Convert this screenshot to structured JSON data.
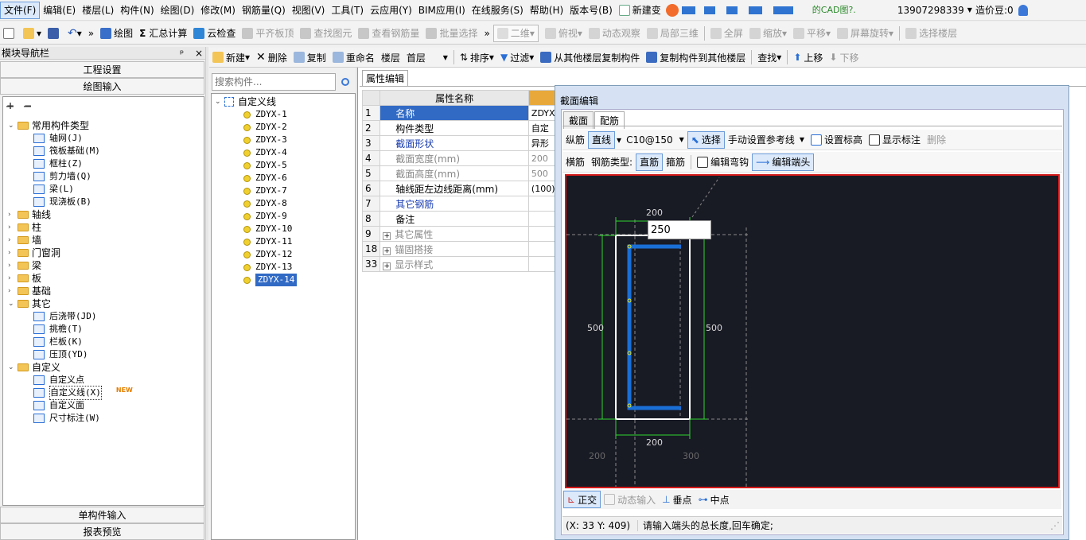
{
  "menu": [
    "文件(F)",
    "编辑(E)",
    "楼层(L)",
    "构件(N)",
    "绘图(D)",
    "修改(M)",
    "钢筋量(Q)",
    "视图(V)",
    "工具(T)",
    "云应用(Y)",
    "BIM应用(I)",
    "在线服务(S)",
    "帮助(H)",
    "版本号(B)"
  ],
  "menu_extra": {
    "new_label": "新建变",
    "cad_hint": "的CAD图?.",
    "phone": "13907298339",
    "price_label": "造价豆:0"
  },
  "toolbar": [
    "绘图",
    "汇总计算",
    "云检查",
    "平齐板顶",
    "查找图元",
    "查看钢筋量",
    "批量选择",
    "二维",
    "俯视",
    "动态观察",
    "局部三维",
    "全屏",
    "缩放",
    "平移",
    "屏幕旋转",
    "选择楼层"
  ],
  "left_panel": {
    "title": "模块导航栏",
    "pin": "ᵖ",
    "close": "×",
    "btn_project": "工程设置",
    "btn_draw": "绘图输入",
    "btn_single": "单构件输入",
    "btn_report": "报表预览",
    "tree": [
      {
        "label": "常用构件类型",
        "level": 0,
        "type": "folder",
        "open": true
      },
      {
        "label": "轴网(J)",
        "level": 1,
        "type": "item"
      },
      {
        "label": "筏板基础(M)",
        "level": 1,
        "type": "item"
      },
      {
        "label": "框柱(Z)",
        "level": 1,
        "type": "item"
      },
      {
        "label": "剪力墙(Q)",
        "level": 1,
        "type": "item"
      },
      {
        "label": "梁(L)",
        "level": 1,
        "type": "item"
      },
      {
        "label": "现浇板(B)",
        "level": 1,
        "type": "item"
      },
      {
        "label": "轴线",
        "level": 0,
        "type": "folder",
        "open": false
      },
      {
        "label": "柱",
        "level": 0,
        "type": "folder",
        "open": false
      },
      {
        "label": "墙",
        "level": 0,
        "type": "folder",
        "open": false
      },
      {
        "label": "门窗洞",
        "level": 0,
        "type": "folder",
        "open": false
      },
      {
        "label": "梁",
        "level": 0,
        "type": "folder",
        "open": false
      },
      {
        "label": "板",
        "level": 0,
        "type": "folder",
        "open": false
      },
      {
        "label": "基础",
        "level": 0,
        "type": "folder",
        "open": false
      },
      {
        "label": "其它",
        "level": 0,
        "type": "folder",
        "open": true
      },
      {
        "label": "后浇带(JD)",
        "level": 1,
        "type": "item"
      },
      {
        "label": "挑檐(T)",
        "level": 1,
        "type": "item"
      },
      {
        "label": "栏板(K)",
        "level": 1,
        "type": "item"
      },
      {
        "label": "压顶(YD)",
        "level": 1,
        "type": "item"
      },
      {
        "label": "自定义",
        "level": 0,
        "type": "folder",
        "open": true
      },
      {
        "label": "自定义点",
        "level": 1,
        "type": "item"
      },
      {
        "label": "自定义线(X)",
        "level": 1,
        "type": "item",
        "selected": true
      },
      {
        "label": "自定义面",
        "level": 1,
        "type": "item"
      },
      {
        "label": "尺寸标注(W)",
        "level": 1,
        "type": "item"
      }
    ],
    "new_badge": "NEW"
  },
  "component_toolbar": [
    "新建",
    "删除",
    "复制",
    "重命名",
    "楼层",
    "首层",
    "排序",
    "过滤",
    "从其他楼层复制构件",
    "复制构件到其他楼层",
    "查找",
    "上移",
    "下移"
  ],
  "search_placeholder": "搜索构件...",
  "component_tree": {
    "root": "自定义线",
    "items": [
      "ZDYX-1",
      "ZDYX-2",
      "ZDYX-3",
      "ZDYX-4",
      "ZDYX-5",
      "ZDYX-6",
      "ZDYX-7",
      "ZDYX-8",
      "ZDYX-9",
      "ZDYX-10",
      "ZDYX-11",
      "ZDYX-12",
      "ZDYX-13",
      "ZDYX-14"
    ],
    "selected": "ZDYX-14"
  },
  "properties": {
    "tab": "属性编辑",
    "header": "属性名称",
    "rows": [
      {
        "num": "1",
        "name": "名称",
        "value": "ZDYX-",
        "selected": true
      },
      {
        "num": "2",
        "name": "构件类型",
        "value": "自定"
      },
      {
        "num": "3",
        "name": "截面形状",
        "value": "异形",
        "blue": true
      },
      {
        "num": "4",
        "name": "截面宽度(mm)",
        "value": "200",
        "gray": true
      },
      {
        "num": "5",
        "name": "截面高度(mm)",
        "value": "500",
        "gray": true
      },
      {
        "num": "6",
        "name": "轴线距左边线距离(mm)",
        "value": "(100)"
      },
      {
        "num": "7",
        "name": "其它钢筋",
        "value": "",
        "blue": true
      },
      {
        "num": "8",
        "name": "备注",
        "value": ""
      },
      {
        "num": "9",
        "name": "其它属性",
        "value": "",
        "expand": true,
        "gray": true
      },
      {
        "num": "18",
        "name": "锚固搭接",
        "value": "",
        "expand": true,
        "gray": true
      },
      {
        "num": "33",
        "name": "显示样式",
        "value": "",
        "expand": true,
        "gray": true
      }
    ]
  },
  "dialog": {
    "title": "截面编辑",
    "tabs": [
      "截面",
      "配筋"
    ],
    "row1": {
      "label": "纵筋",
      "line": "直线",
      "spec": "C10@150",
      "select": "选择",
      "ref": "手动设置参考线",
      "elev": "设置标高",
      "show": "显示标注",
      "delete": "删除"
    },
    "row2": {
      "label": "横筋",
      "type_label": "钢筋类型:",
      "straight": "直筋",
      "stirrup": "箍筋",
      "bend": "编辑弯钩",
      "end": "编辑端头"
    },
    "canvas": {
      "dim_top": "200",
      "dim_bottom": "200",
      "dim_left": "500",
      "dim_right": "500",
      "dim_bl": "200",
      "dim_br": "300",
      "input": "250"
    },
    "bottom": {
      "ortho": "正交",
      "dyn": "动态输入",
      "perp": "垂点",
      "mid": "中点"
    },
    "status": {
      "coord": "(X: 33 Y: 409)",
      "msg": "请输入端头的总长度,回车确定;"
    }
  },
  "colors": {
    "rebar": "#1a6fd6",
    "canvas_bg": "#181a24",
    "border": "#d41919",
    "dim": "#2fd62f",
    "selected": "#316ac5"
  }
}
